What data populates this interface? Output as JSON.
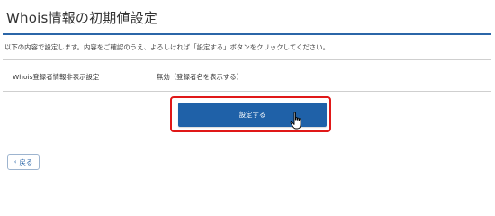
{
  "page": {
    "title": "Whois情報の初期値設定",
    "instruction": "以下の内容で設定します。内容をご確認のうえ、よろしければ「設定する」ボタンをクリックしてください。"
  },
  "setting_row": {
    "label": "Whois登録者情報非表示設定",
    "value": "無効（登録者名を表示する）"
  },
  "actions": {
    "submit_label": "設定する",
    "back_label": "戻る",
    "back_icon": "‹"
  },
  "colors": {
    "accent": "#2b66a8",
    "button_bg": "#1f61a8",
    "highlight": "#e01818"
  },
  "icons": {
    "cursor": "pointer-cursor-icon",
    "back": "chevron-left-icon"
  }
}
